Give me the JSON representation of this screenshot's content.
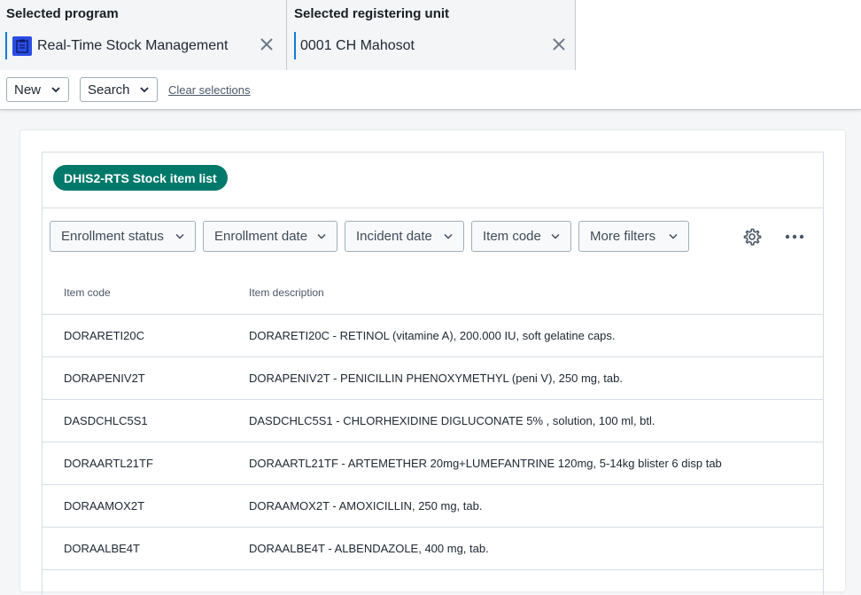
{
  "top_bar": {
    "program": {
      "title": "Selected program",
      "value": "Real-Time Stock Management"
    },
    "registering_unit": {
      "title": "Selected registering unit",
      "value": "0001 CH Mahosot"
    }
  },
  "actions": {
    "new_label": "New",
    "search_label": "Search",
    "clear_label": "Clear selections"
  },
  "list": {
    "chip_label": "DHIS2-RTS Stock item list",
    "filters": [
      "Enrollment status",
      "Enrollment date",
      "Incident date",
      "Item code",
      "More filters"
    ],
    "columns": [
      "Item code",
      "Item description"
    ],
    "rows": [
      {
        "code": "DORARETI20C",
        "description": "DORARETI20C - RETINOL (vitamine A), 200.000 IU, soft gelatine caps."
      },
      {
        "code": "DORAPENIV2T",
        "description": "DORAPENIV2T - PENICILLIN PHENOXYMETHYL (peni V), 250 mg, tab."
      },
      {
        "code": "DASDCHLC5S1",
        "description": "DASDCHLC5S1 - CHLORHEXIDINE DIGLUCONATE 5% , solution, 100 ml, btl."
      },
      {
        "code": "DORAARTL21TF",
        "description": "DORAARTL21TF - ARTEMETHER 20mg+LUMEFANTRINE 120mg, 5-14kg blister 6 disp tab"
      },
      {
        "code": "DORAAMOX2T",
        "description": "DORAAMOX2T - AMOXICILLIN, 250 mg, tab."
      },
      {
        "code": "DORAALBE4T",
        "description": "DORAALBE4T - ALBENDAZOLE, 400 mg, tab."
      }
    ]
  },
  "icons": {
    "program": "clipboard-icon",
    "settings": "gear-icon",
    "more": "more-horizontal-icon"
  },
  "colors": {
    "accent": "#147cd7",
    "chip": "#00796b",
    "program_icon": "#2b4de6"
  }
}
